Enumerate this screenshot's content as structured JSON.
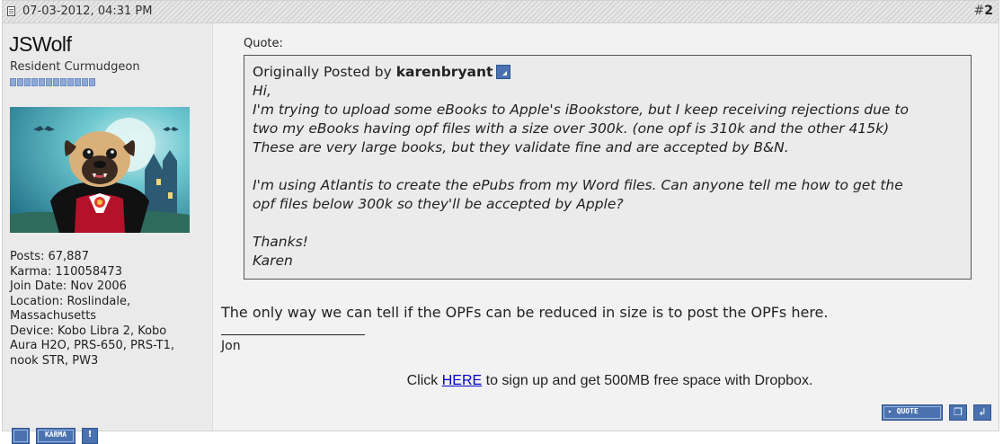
{
  "post": {
    "date": "07-03-2012, 04:31 PM",
    "number_prefix": "#",
    "number": "2"
  },
  "user": {
    "name": "JSWolf",
    "title": "Resident Curmudgeon",
    "reputation_pips": 12,
    "stats": [
      "Posts: 67,887",
      "Karma: 110058473",
      "Join Date: Nov 2006",
      "Location: Roslindale,",
      "Massachusetts",
      "Device: Kobo Libra 2, Kobo",
      "Aura H2O, PRS-650, PRS-T1,",
      "nook STR, PW3"
    ],
    "karma_button": "KARMA",
    "report_glyph": "!"
  },
  "quote": {
    "label": "Quote:",
    "posted_by_prefix": "Originally Posted by",
    "author": "karenbryant",
    "lines": [
      "Hi,",
      "I'm trying to upload some eBooks to Apple's iBookstore, but I keep receiving rejections due to",
      "two my eBooks having opf files with a size over 300k. (one opf is 310k and the other 415k)",
      "These are very large books, but they validate fine and are accepted by B&N.",
      "",
      "I'm using Atlantis to create the ePubs from my Word files. Can anyone tell me how to get the",
      "opf files below 300k so they'll be accepted by Apple?",
      "",
      "Thanks!",
      "Karen"
    ]
  },
  "message": "The only way we can tell if the OPFs can be reduced in size is to post the OPFs here.",
  "signature": {
    "name": "Jon",
    "prefix": "Click",
    "link": "HERE",
    "suffix": "to sign up and get 500MB free space with Dropbox."
  },
  "actions": {
    "quote_button": "▸ QUOTE",
    "multiquote_glyph": "❐",
    "reply_glyph": "↲"
  },
  "colors": {
    "button_blue": "#4a72b0",
    "link": "#0000cc",
    "rep_pip": "#8ea9d6"
  }
}
